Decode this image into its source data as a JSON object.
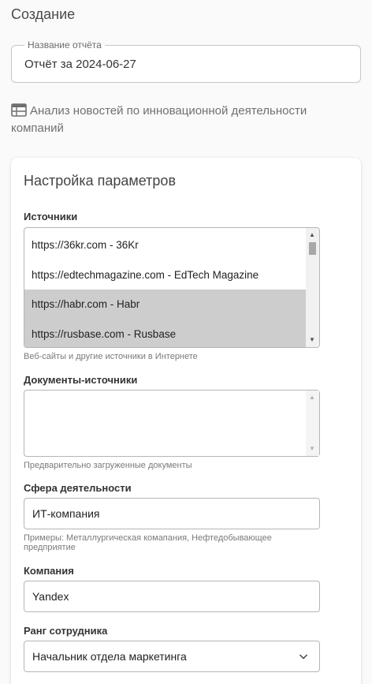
{
  "header": {
    "title": "Создание"
  },
  "report_name": {
    "legend": "Название отчёта",
    "value": "Отчёт за 2024-06-27"
  },
  "template": {
    "icon": "table-icon",
    "text": "Анализ новостей по инновационной деятельности компаний"
  },
  "params": {
    "title": "Настройка параметров",
    "sources": {
      "label": "Источники",
      "options": [
        {
          "text": "https://36kr.com - 36Kr",
          "selected": false
        },
        {
          "text": "https://edtechmagazine.com - EdTech Magazine",
          "selected": false
        },
        {
          "text": "https://habr.com - Habr",
          "selected": true
        },
        {
          "text": "https://rusbase.com - Rusbase",
          "selected": true
        }
      ],
      "hint": "Веб-сайты и другие источники в Интернете"
    },
    "documents": {
      "label": "Документы-источники",
      "hint": "Предварительно загруженные документы"
    },
    "sphere": {
      "label": "Сфера деятельности",
      "value": "ИТ-компания",
      "hint": "Примеры: Металлургическая комапания, Нефтедобывающее предприятие"
    },
    "company": {
      "label": "Компания",
      "value": "Yandex"
    },
    "rank": {
      "label": "Ранг сотрудника",
      "value": "Начальник отдела маркетинга"
    }
  }
}
